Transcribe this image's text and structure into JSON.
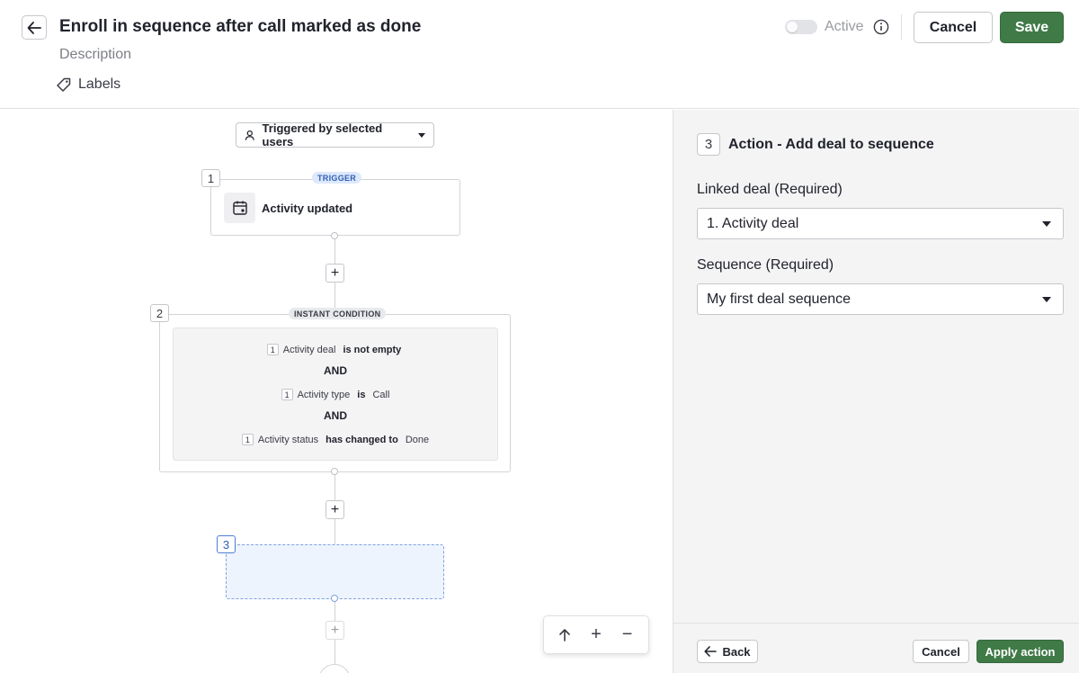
{
  "header": {
    "title": "Enroll in sequence after call marked as done",
    "description_placeholder": "Description",
    "labels_label": "Labels",
    "active_label": "Active",
    "active_enabled": false,
    "cancel_label": "Cancel",
    "save_label": "Save"
  },
  "canvas": {
    "trigger_select_label": "Triggered by selected users",
    "nodes": [
      {
        "number": "1",
        "tag": "TRIGGER",
        "label": "Activity updated"
      },
      {
        "number": "2",
        "tag": "INSTANT CONDITION",
        "conditions": [
          {
            "ref": "1",
            "field": "Activity deal",
            "operator": "is not empty",
            "value": ""
          },
          {
            "ref": "1",
            "field": "Activity type",
            "operator": "is",
            "value": "Call"
          },
          {
            "ref": "1",
            "field": "Activity status",
            "operator": "has changed to",
            "value": "Done"
          }
        ],
        "joiner": "AND"
      },
      {
        "number": "3"
      }
    ],
    "add_step_label": "+",
    "zoom": {
      "fit_icon": "arrow-up-icon",
      "zoom_in": "+",
      "zoom_out": "−"
    }
  },
  "panel": {
    "step_number": "3",
    "title": "Action - Add deal to sequence",
    "linked_deal_label": "Linked deal (Required)",
    "linked_deal_value": "1. Activity deal",
    "sequence_label": "Sequence (Required)",
    "sequence_value": "My first deal sequence",
    "back_label": "Back",
    "cancel_label": "Cancel",
    "apply_label": "Apply action"
  },
  "colors": {
    "primary_green": "#3f7a47",
    "selected_blue": "#eef4fd",
    "trigger_tag": "#dde8fb"
  }
}
